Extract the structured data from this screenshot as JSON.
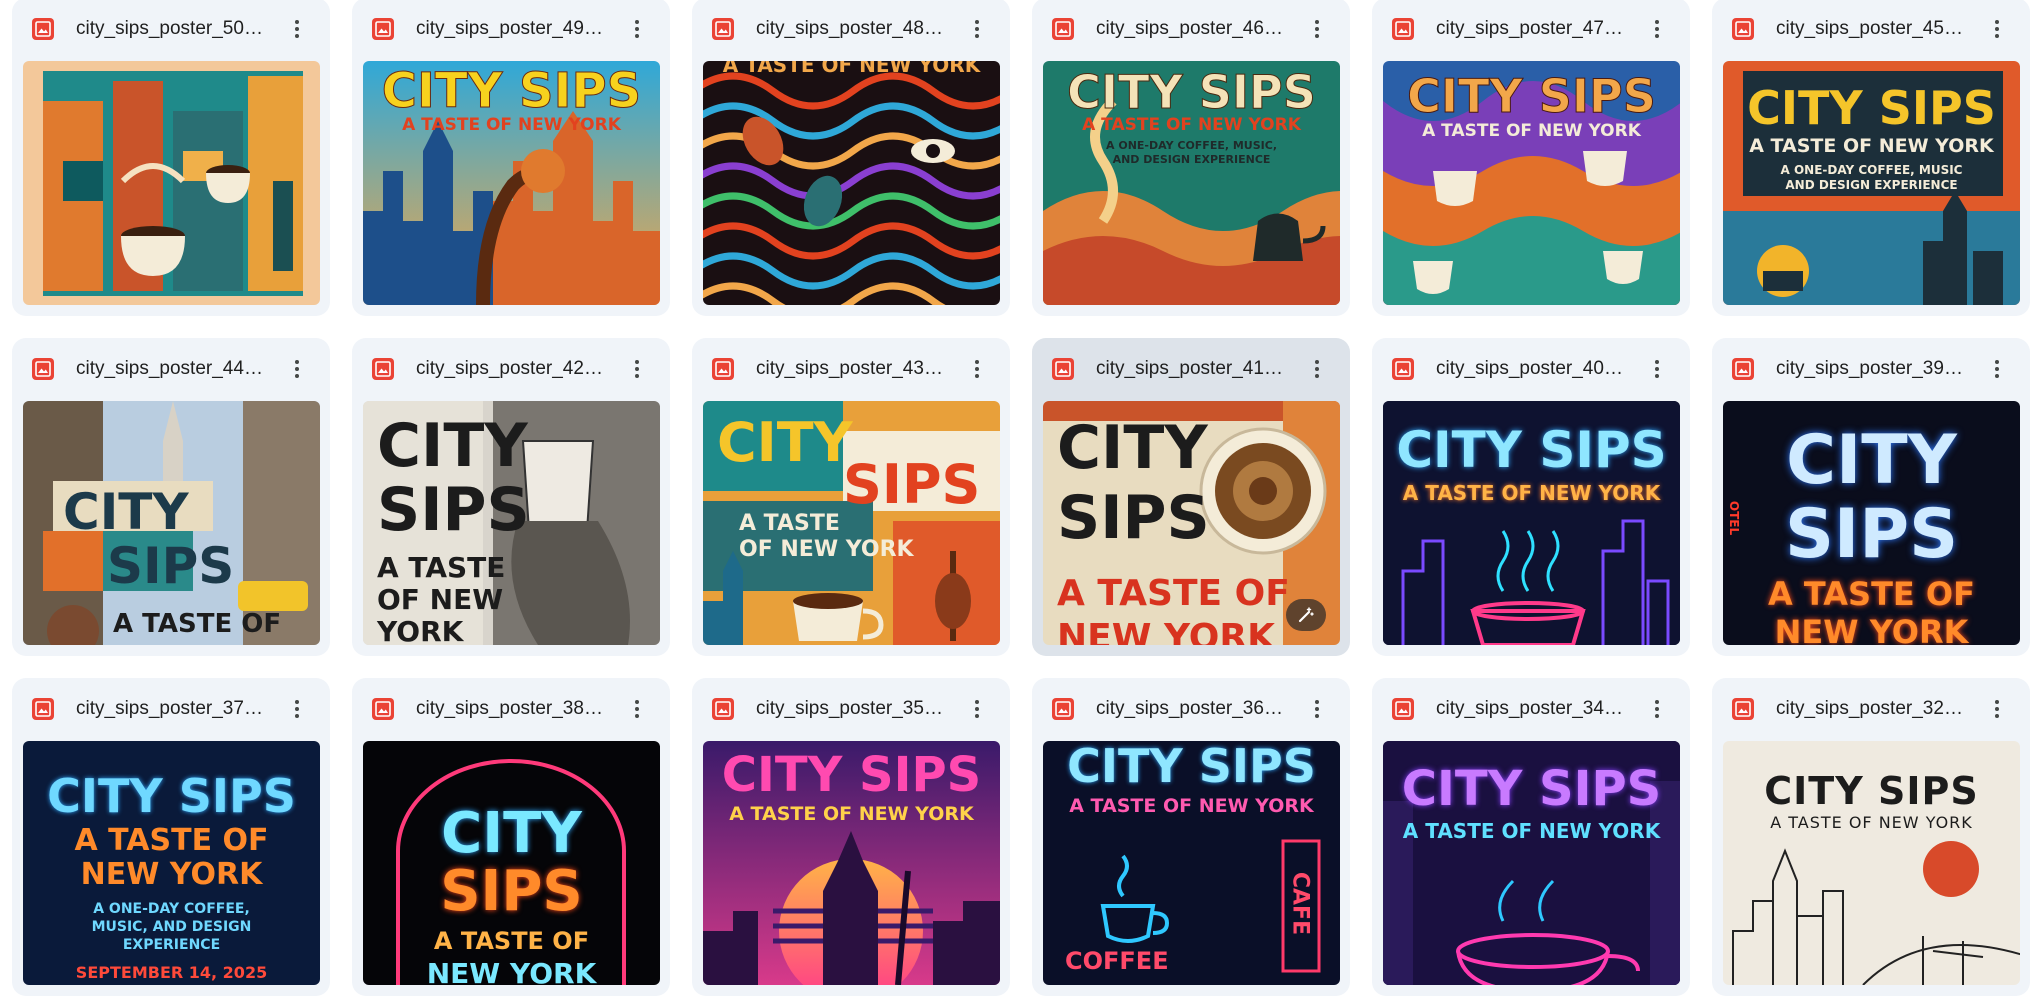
{
  "files": [
    {
      "name": "city_sips_poster_50_s...",
      "poster": {
        "lines": []
      }
    },
    {
      "name": "city_sips_poster_49_s...",
      "poster": {
        "lines": [
          "CITY SIPS",
          "A TASTE OF NEW YORK"
        ]
      }
    },
    {
      "name": "city_sips_poster_48_p...",
      "poster": {
        "lines": [
          "A TASTE OF NEW YORK"
        ]
      }
    },
    {
      "name": "city_sips_poster_46_s...",
      "poster": {
        "lines": [
          "CITY SIPS",
          "A TASTE OF NEW YORK",
          "A ONE-DAY COFFEE, MUSIC,",
          "AND DESIGN EXPERIENCE"
        ]
      }
    },
    {
      "name": "city_sips_poster_47_s...",
      "poster": {
        "lines": [
          "CITY SIPS",
          "A TASTE OF NEW YORK"
        ]
      }
    },
    {
      "name": "city_sips_poster_45_d...",
      "poster": {
        "lines": [
          "CITY SIPS",
          "A TASTE OF NEW YORK",
          "A ONE-DAY COFFEE, MUSIC",
          "AND DESIGN EXPERIENCE"
        ]
      }
    },
    {
      "name": "city_sips_poster_44_...",
      "poster": {
        "lines": [
          "CITY",
          "SIPS",
          "A TASTE OF"
        ]
      }
    },
    {
      "name": "city_sips_poster_42_p...",
      "poster": {
        "lines": [
          "CITY",
          "SIPS",
          "A TASTE",
          "OF NEW",
          "YORK"
        ]
      }
    },
    {
      "name": "city_sips_poster_43_p...",
      "poster": {
        "lines": [
          "CITY",
          "SIPS",
          "A TASTE",
          "OF NEW YORK"
        ]
      }
    },
    {
      "name": "city_sips_poster_41_...",
      "poster": {
        "lines": [
          "CITY",
          "SIPS",
          "A TASTE OF",
          "NEW YORK"
        ]
      }
    },
    {
      "name": "city_sips_poster_40_...",
      "poster": {
        "lines": [
          "CITY SIPS",
          "A TASTE OF NEW YORK"
        ]
      }
    },
    {
      "name": "city_sips_poster_39_e...",
      "poster": {
        "lines": [
          "CITY",
          "SIPS",
          "A TASTE OF",
          "NEW YORK",
          "OTEL"
        ]
      }
    },
    {
      "name": "city_sips_poster_37_n...",
      "poster": {
        "lines": [
          "CITY SIPS",
          "A TASTE OF",
          "NEW YORK",
          "A ONE-DAY COFFEE,",
          "MUSIC, AND DESIGN",
          "EXPERIENCE",
          "SEPTEMBER 14, 2025"
        ]
      }
    },
    {
      "name": "city_sips_poster_38_e...",
      "poster": {
        "lines": [
          "CITY",
          "SIPS",
          "A TASTE OF",
          "NEW YORK"
        ]
      }
    },
    {
      "name": "city_sips_poster_35_8...",
      "poster": {
        "lines": [
          "CITY SIPS",
          "A TASTE OF NEW YORK"
        ]
      }
    },
    {
      "name": "city_sips_poster_36_e...",
      "poster": {
        "lines": [
          "CITY SIPS",
          "A TASTE OF NEW YORK",
          "COFFEE",
          "CAFE"
        ]
      }
    },
    {
      "name": "city_sips_poster_34_c...",
      "poster": {
        "lines": [
          "CITY SIPS",
          "A TASTE OF NEW YORK"
        ]
      }
    },
    {
      "name": "city_sips_poster_32_j...",
      "poster": {
        "lines": [
          "CITY SIPS",
          "A TASTE OF NEW YORK"
        ]
      }
    }
  ],
  "icons": {
    "file_type": "image-file-icon",
    "more": "more-vert-icon",
    "edit": "magic-edit-icon"
  },
  "colors": {
    "card_bg": "#f0f4f9",
    "card_hover_bg": "#dde3ea",
    "image_icon": "#ea4335",
    "title": "#1f1f1f"
  }
}
